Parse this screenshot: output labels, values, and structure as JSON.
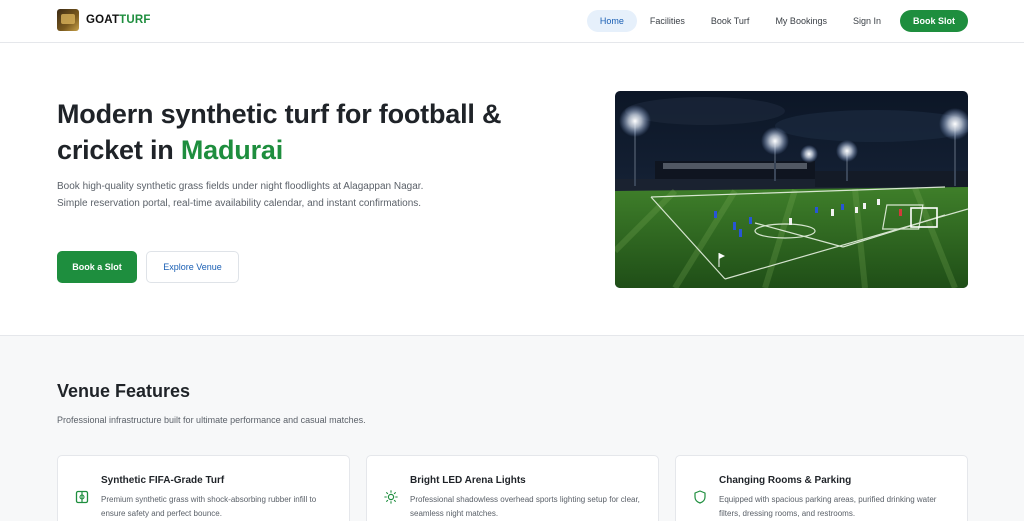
{
  "brand": {
    "name_part1": "GOAT",
    "name_part2": "TURF"
  },
  "nav": {
    "items": [
      {
        "label": "Home",
        "active": true
      },
      {
        "label": "Facilities"
      },
      {
        "label": "Book Turf"
      },
      {
        "label": "My Bookings"
      },
      {
        "label": "Sign In"
      }
    ],
    "cta_label": "Book Slot"
  },
  "hero": {
    "title_main": "Modern synthetic turf for football & cricket in ",
    "title_highlight": "Madurai",
    "description": "Book high-quality synthetic grass fields under night floodlights at Alagappan Nagar. Simple reservation portal, real-time availability calendar, and instant confirmations.",
    "primary_button": "Book a Slot",
    "secondary_button": "Explore Venue"
  },
  "features": {
    "title": "Venue Features",
    "subtitle": "Professional infrastructure built for ultimate performance and casual matches.",
    "cards": [
      {
        "icon": "field-icon",
        "title": "Synthetic FIFA-Grade Turf",
        "description": "Premium synthetic grass with shock-absorbing rubber infill to ensure safety and perfect bounce."
      },
      {
        "icon": "light-icon",
        "title": "Bright LED Arena Lights",
        "description": "Professional shadowless overhead sports lighting setup for clear, seamless night matches."
      },
      {
        "icon": "shield-icon",
        "title": "Changing Rooms & Parking",
        "description": "Equipped with spacious parking areas, purified drinking water filters, dressing rooms, and restrooms."
      }
    ]
  },
  "colors": {
    "accent": "#1e8e3e",
    "link": "#1a5fb4",
    "nav_active_bg": "#e6f0fb"
  }
}
